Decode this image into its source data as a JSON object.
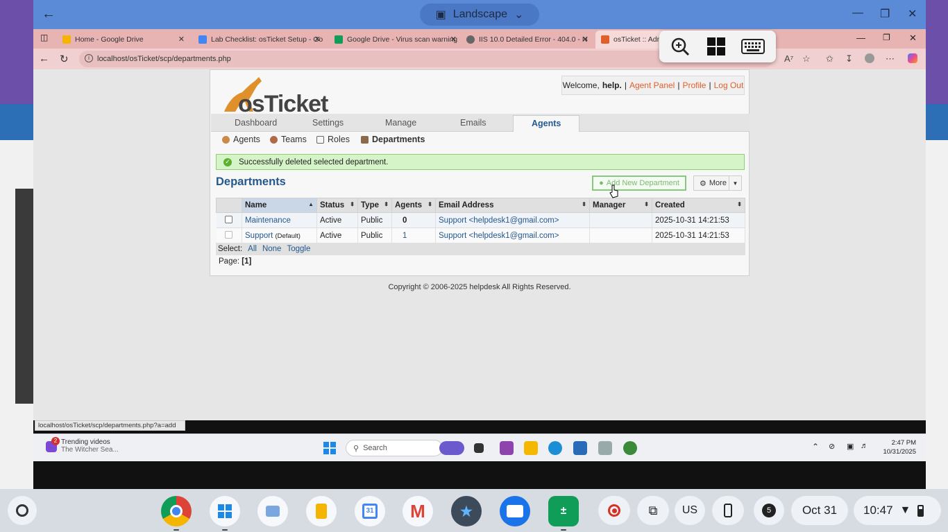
{
  "remote_window": {
    "title": "Landscape"
  },
  "browser": {
    "tabs": [
      {
        "label": "Home - Google Drive",
        "color": "#f4b400"
      },
      {
        "label": "Lab Checklist: osTicket Setup - Go",
        "color": "#4285f4"
      },
      {
        "label": "Google Drive - Virus scan warning",
        "color": "#0f9d58"
      },
      {
        "label": "IIS 10.0 Detailed Error - 404.0 - N",
        "color": "#666666"
      },
      {
        "label": "osTicket :: Admi",
        "color": "#e0602b"
      }
    ],
    "url": "localhost/osTicket/scp/departments.php",
    "status_url": "localhost/osTicket/scp/departments.php?a=add"
  },
  "osticket": {
    "logo_text": "osTicket",
    "welcome": {
      "prefix": "Welcome,",
      "user": "help.",
      "agent_panel": "Agent Panel",
      "profile": "Profile",
      "logout": "Log Out"
    },
    "nav": [
      "Dashboard",
      "Settings",
      "Manage",
      "Emails",
      "Agents"
    ],
    "subnav": [
      "Agents",
      "Teams",
      "Roles",
      "Departments"
    ],
    "alert": "Successfully deleted selected department.",
    "page_title": "Departments",
    "add_button": "Add New Department",
    "more_button": "More",
    "columns": [
      "Name",
      "Status",
      "Type",
      "Agents",
      "Email Address",
      "Manager",
      "Created"
    ],
    "rows": [
      {
        "name": "Maintenance",
        "default": "",
        "status": "Active",
        "type": "Public",
        "agents": "0",
        "email": "Support <helpdesk1@gmail.com>",
        "manager": "",
        "created": "2025-10-31 14:21:53"
      },
      {
        "name": "Support",
        "default": "(Default)",
        "status": "Active",
        "type": "Public",
        "agents": "1",
        "email": "Support <helpdesk1@gmail.com>",
        "manager": "",
        "created": "2025-10-31 14:21:53"
      }
    ],
    "select": {
      "label": "Select:",
      "all": "All",
      "none": "None",
      "toggle": "Toggle"
    },
    "page": {
      "label": "Page:",
      "value": "[1]"
    },
    "copyright": "Copyright © 2006-2025 helpdesk All Rights Reserved."
  },
  "windows_taskbar": {
    "news_badge": "2",
    "news_title": "Trending videos",
    "news_sub": "The Witcher Sea...",
    "search": "Search",
    "time": "2:47 PM",
    "date": "10/31/2025"
  },
  "chromeos_shelf": {
    "locale": "US",
    "notif_count": "5",
    "date": "Oct 31",
    "time": "10:47"
  }
}
